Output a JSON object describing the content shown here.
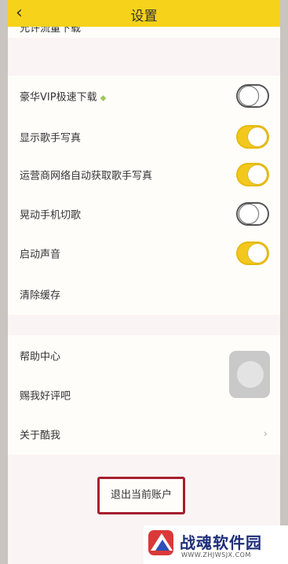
{
  "header": {
    "title": "设置",
    "back": "‹"
  },
  "cut_row": {
    "label": "允许流量下载"
  },
  "settings": {
    "vip_download": {
      "label": "豪华VIP极速下载",
      "state": "off"
    },
    "show_singer_photo": {
      "label": "显示歌手写真",
      "state": "on"
    },
    "carrier_auto_photo": {
      "label": "运营商网络自动获取歌手写真",
      "state": "on"
    },
    "shake_switch": {
      "label": "晃动手机切歌",
      "state": "off"
    },
    "startup_sound": {
      "label": "启动声音",
      "state": "on"
    },
    "clear_cache": {
      "label": "清除缓存"
    },
    "help_center": {
      "label": "帮助中心"
    },
    "rate_us": {
      "label": "赐我好评吧"
    },
    "about": {
      "label": "关于酷我"
    }
  },
  "logout": {
    "label": "退出当前账户"
  },
  "icons": {
    "diamond": "◆",
    "chevron": "›"
  },
  "watermark": {
    "name": "战魂软件园",
    "url": "WWW.ZHJWSJX.COM"
  },
  "colors": {
    "accent": "#f7d21a",
    "toggle_on": "#f3c81c",
    "highlight": "#a61f2f"
  }
}
